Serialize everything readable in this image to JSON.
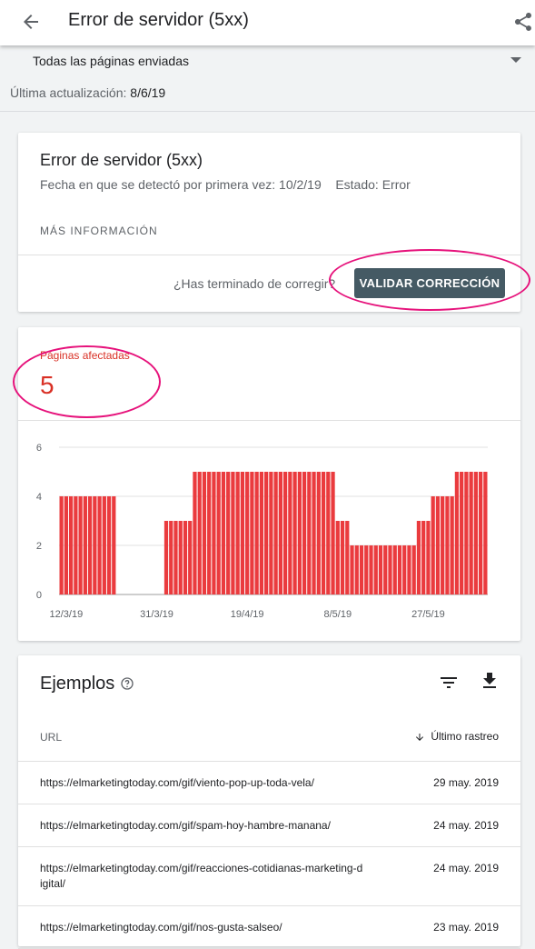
{
  "appbar": {
    "title": "Error de servidor (5xx)",
    "back_icon": "arrow-back-icon",
    "share_icon": "share-icon"
  },
  "filter": {
    "selected": "Todas las páginas enviadas",
    "updated_label": "Última actualización:",
    "updated_value": "8/6/19"
  },
  "issue": {
    "title": "Error de servidor (5xx)",
    "detected_label": "Fecha en que se detectó por primera vez:",
    "detected_value": "10/2/19",
    "status_label": "Estado:",
    "status_value": "Error",
    "more_info": "MÁS INFORMACIÓN",
    "question": "¿Has terminado de corregir?",
    "validate_button": "VALIDAR CORRECCIÓN"
  },
  "affected": {
    "label": "Páginas afectadas",
    "value": "5",
    "color": "#d93025"
  },
  "chart_data": {
    "type": "bar",
    "color": "#ea3b3e",
    "ylim": [
      0,
      6
    ],
    "yticks": [
      "0",
      "2",
      "4",
      "6"
    ],
    "xticks": [
      {
        "label": "12/3/19",
        "index": 1
      },
      {
        "label": "31/3/19",
        "index": 20
      },
      {
        "label": "19/4/19",
        "index": 39
      },
      {
        "label": "8/5/19",
        "index": 58
      },
      {
        "label": "27/5/19",
        "index": 77
      }
    ],
    "values": [
      4,
      4,
      4,
      4,
      4,
      4,
      4,
      4,
      4,
      4,
      4,
      4,
      0,
      0,
      0,
      0,
      0,
      0,
      0,
      0,
      0,
      0,
      3,
      3,
      3,
      3,
      3,
      3,
      5,
      5,
      5,
      5,
      5,
      5,
      5,
      5,
      5,
      5,
      5,
      5,
      5,
      5,
      5,
      5,
      5,
      5,
      5,
      5,
      5,
      5,
      5,
      5,
      5,
      5,
      5,
      5,
      5,
      5,
      3,
      3,
      3,
      2,
      2,
      2,
      2,
      2,
      2,
      2,
      2,
      2,
      2,
      2,
      2,
      2,
      2,
      3,
      3,
      3,
      4,
      4,
      4,
      4,
      4,
      5,
      5,
      5,
      5,
      5,
      5,
      5
    ]
  },
  "examples": {
    "title": "Ejemplos",
    "help_icon": "help-icon",
    "filter_icon": "filter-icon",
    "download_icon": "download-icon",
    "col_url": "URL",
    "col_date": "Último rastreo",
    "rows": [
      {
        "url": "https://elmarketingtoday.com/gif/viento-pop-up-toda-vela/",
        "date": "29 may. 2019"
      },
      {
        "url": "https://elmarketingtoday.com/gif/spam-hoy-hambre-manana/",
        "date": "24 may. 2019"
      },
      {
        "url": "https://elmarketingtoday.com/gif/reacciones-cotidianas-marketing-digital/",
        "date": "24 may. 2019"
      },
      {
        "url": "https://elmarketingtoday.com/gif/nos-gusta-salseo/",
        "date": "23 may. 2019"
      }
    ]
  }
}
